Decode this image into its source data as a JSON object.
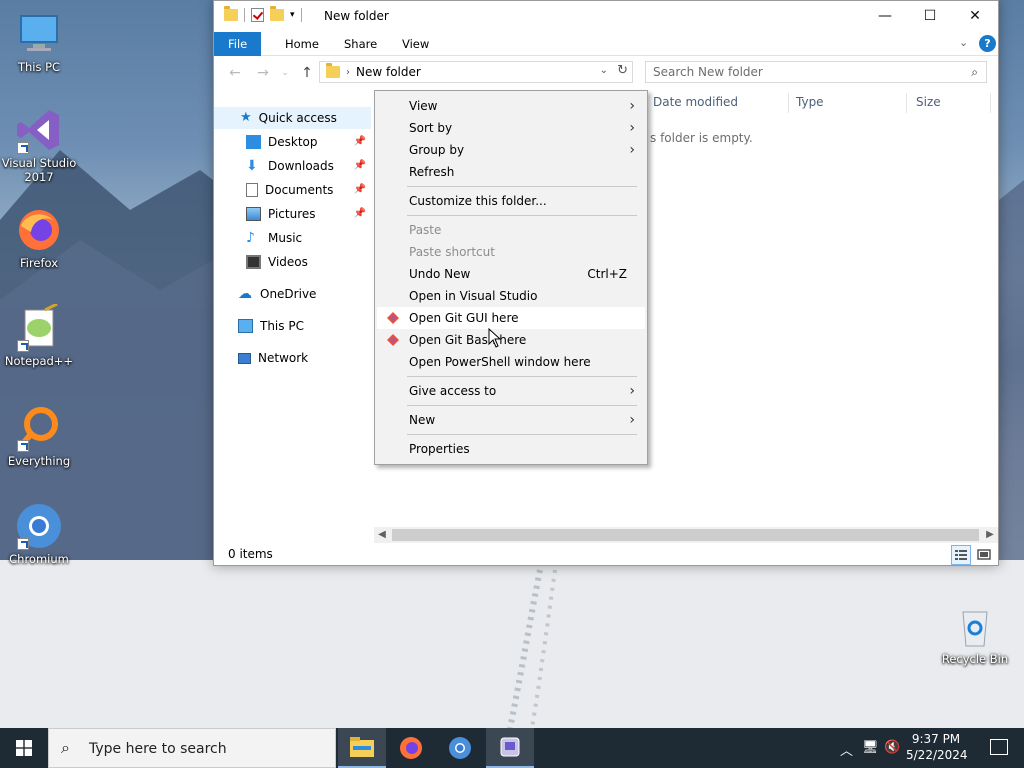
{
  "desktop": {
    "icons": [
      {
        "label": "This PC"
      },
      {
        "label": "Visual Studio 2017"
      },
      {
        "label": "Firefox"
      },
      {
        "label": "Notepad++"
      },
      {
        "label": "Everything"
      },
      {
        "label": "Chromium"
      },
      {
        "label": "Recycle Bin"
      }
    ]
  },
  "window": {
    "title": "New folder",
    "ribbon_tabs": [
      "File",
      "Home",
      "Share",
      "View"
    ],
    "address": {
      "current": "New folder"
    },
    "search": {
      "placeholder": "Search New folder"
    },
    "nav": {
      "quick_access": "Quick access",
      "items": [
        {
          "label": "Desktop",
          "pinned": true
        },
        {
          "label": "Downloads",
          "pinned": true
        },
        {
          "label": "Documents",
          "pinned": true
        },
        {
          "label": "Pictures",
          "pinned": true
        },
        {
          "label": "Music",
          "pinned": false
        },
        {
          "label": "Videos",
          "pinned": false
        }
      ],
      "onedrive": "OneDrive",
      "this_pc": "This PC",
      "network": "Network"
    },
    "columns": [
      "Date modified",
      "Type",
      "Size"
    ],
    "empty_text": "s folder is empty.",
    "status": {
      "count": "0 items"
    }
  },
  "context_menu": {
    "view": "View",
    "sort_by": "Sort by",
    "group_by": "Group by",
    "refresh": "Refresh",
    "customize": "Customize this folder...",
    "paste": "Paste",
    "paste_shortcut": "Paste shortcut",
    "undo_new": "Undo New",
    "undo_shortcut": "Ctrl+Z",
    "open_vs": "Open in Visual Studio",
    "open_git_gui": "Open Git GUI here",
    "open_git_bash": "Open Git Bash here",
    "open_powershell": "Open PowerShell window here",
    "give_access": "Give access to",
    "new": "New",
    "properties": "Properties"
  },
  "taskbar": {
    "search_placeholder": "Type here to search",
    "time": "9:37 PM",
    "date": "5/22/2024"
  },
  "colors": {
    "accent": "#1979ca",
    "taskbar": "#1e2a34",
    "menu_bg": "#f2f2f2"
  }
}
